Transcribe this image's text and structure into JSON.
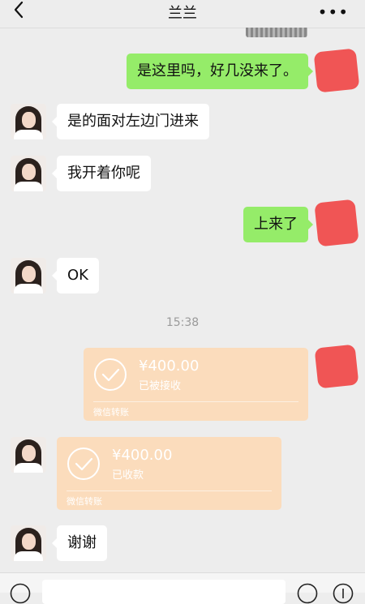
{
  "header": {
    "title": "兰兰",
    "more": "•••"
  },
  "messages": [
    {
      "side": "right",
      "text": "是这里吗，好几没来了。"
    },
    {
      "side": "left",
      "text": "是的面对左边门进来"
    },
    {
      "side": "left",
      "text": "我开着你呢"
    },
    {
      "side": "right",
      "text": "上来了"
    },
    {
      "side": "left",
      "text": "OK"
    }
  ],
  "timestamp": "15:38",
  "transfers": [
    {
      "side": "right",
      "amount": "¥400.00",
      "status": "已被接收",
      "footer": "微信转账"
    },
    {
      "side": "left",
      "amount": "¥400.00",
      "status": "已收款",
      "footer": "微信转账"
    }
  ],
  "last_message": {
    "side": "left",
    "text": "谢谢"
  },
  "colors": {
    "background": "#ededed",
    "sent_bubble": "#95ec69",
    "received_bubble": "#ffffff",
    "transfer_card": "#fbdcbc",
    "redaction": "#f05555"
  },
  "icons": [
    "back-arrow-icon",
    "more-dots-icon",
    "check-circle-icon",
    "voice-icon",
    "emoji-icon",
    "plus-icon"
  ]
}
